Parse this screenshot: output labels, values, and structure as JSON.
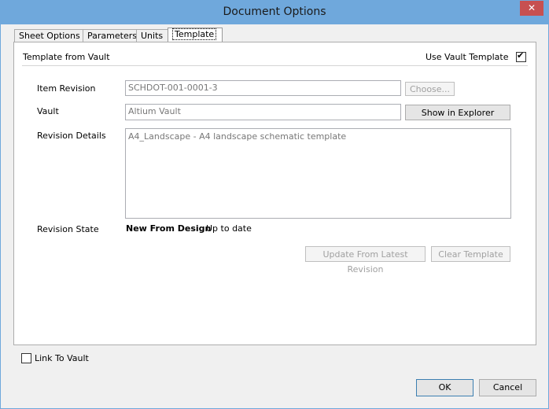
{
  "window": {
    "title": "Document Options",
    "close_glyph": "✕"
  },
  "tabs": [
    {
      "label": "Sheet Options"
    },
    {
      "label": "Parameters"
    },
    {
      "label": "Units"
    },
    {
      "label": "Template"
    }
  ],
  "section": {
    "title": "Template from Vault",
    "use_vault_template_label": "Use Vault Template",
    "use_vault_template_checked": true
  },
  "fields": {
    "item_revision_label": "Item Revision",
    "item_revision_value": "SCHDOT-001-0001-3",
    "choose_label": "Choose...",
    "vault_label": "Vault",
    "vault_value": "Altium Vault",
    "show_in_explorer_label": "Show in Explorer",
    "revision_details_label": "Revision Details",
    "revision_details_value": "A4_Landscape - A4 landscape schematic template",
    "revision_state_label": "Revision State",
    "revision_state_value": "New From Design",
    "revision_status": "Up to date",
    "update_button_label": "Update From Latest Revision",
    "clear_button_label": "Clear Template"
  },
  "footer": {
    "link_to_vault_label": "Link To Vault",
    "link_to_vault_checked": false,
    "ok_label": "OK",
    "cancel_label": "Cancel"
  },
  "colors": {
    "titlebar": "#6fa8dc",
    "close_button": "#c75050"
  }
}
